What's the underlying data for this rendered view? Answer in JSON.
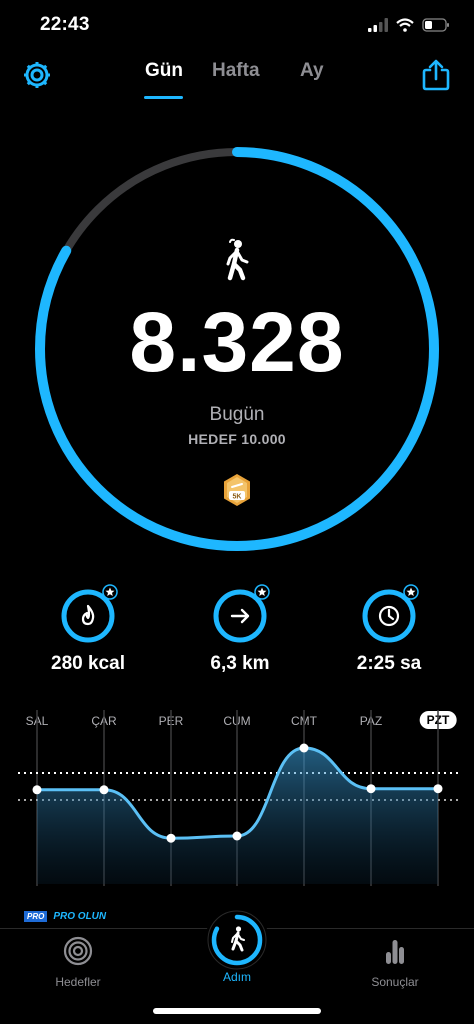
{
  "status": {
    "time": "22:43"
  },
  "nav": {
    "tabs": [
      "Gün",
      "Hafta",
      "Ay"
    ],
    "active_tab": "Gün"
  },
  "main": {
    "steps": "8.328",
    "period_label": "Bugün",
    "goal_label": "HEDEF 10.000",
    "goal_progress": 0.8328,
    "badge_label": "5K"
  },
  "stats": [
    {
      "icon": "flame-icon",
      "value": "280 kcal"
    },
    {
      "icon": "arrow-right-icon",
      "value": "6,3 km"
    },
    {
      "icon": "clock-icon",
      "value": "2:25 sa"
    }
  ],
  "week_chart": {
    "days": [
      "SAL",
      "ÇAR",
      "PER",
      "CUM",
      "CMT",
      "PAZ",
      "PZT"
    ],
    "active_day": "PZT",
    "relative_values": [
      0.62,
      0.62,
      0.18,
      0.2,
      1.0,
      0.63,
      0.63
    ]
  },
  "promo": {
    "tag": "PRO",
    "text": "PRO OLUN"
  },
  "tabbar": {
    "items": [
      "Hedefler",
      "Adım",
      "Sonuçlar"
    ],
    "active": "Adım"
  },
  "colors": {
    "accent": "#1eb7ff",
    "track": "#3a3a3c",
    "background": "#000000"
  }
}
